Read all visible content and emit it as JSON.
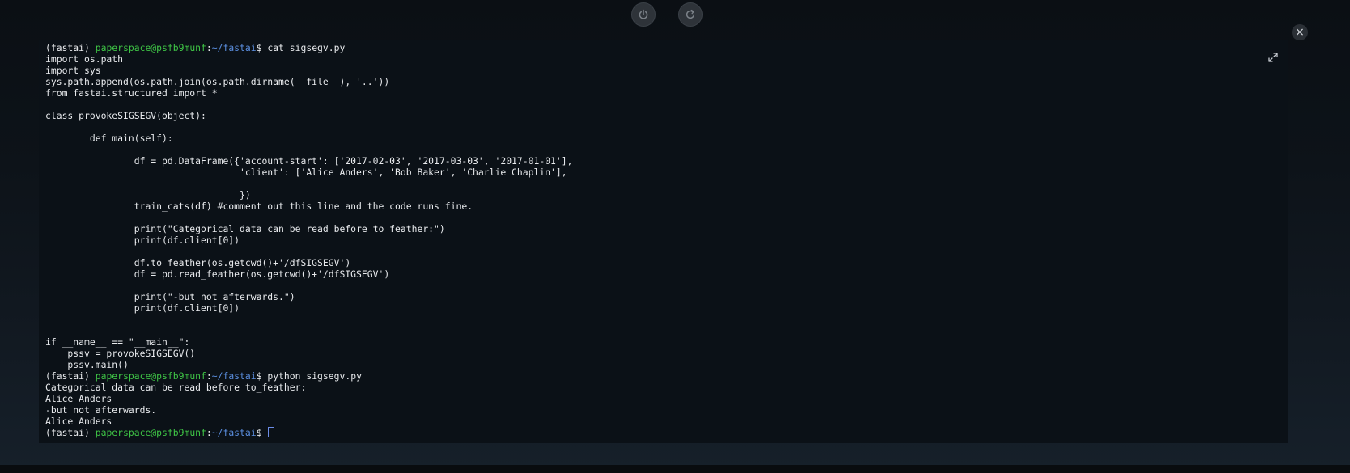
{
  "prompt": {
    "venv": "(fastai)",
    "userhost": "paperspace@psfb9munf",
    "sep": ":",
    "path": "~/fastai",
    "dollar": "$"
  },
  "lines": [
    {
      "type": "prompt",
      "cmd": " cat sigsegv.py"
    },
    {
      "type": "text",
      "text": "import os.path"
    },
    {
      "type": "text",
      "text": "import sys"
    },
    {
      "type": "text",
      "text": "sys.path.append(os.path.join(os.path.dirname(__file__), '..'))"
    },
    {
      "type": "text",
      "text": "from fastai.structured import *"
    },
    {
      "type": "text",
      "text": ""
    },
    {
      "type": "text",
      "text": "class provokeSIGSEGV(object):"
    },
    {
      "type": "text",
      "text": ""
    },
    {
      "type": "text",
      "text": "        def main(self):"
    },
    {
      "type": "text",
      "text": ""
    },
    {
      "type": "text",
      "text": "                df = pd.DataFrame({'account-start': ['2017-02-03', '2017-03-03', '2017-01-01'],"
    },
    {
      "type": "text",
      "text": "                                   'client': ['Alice Anders', 'Bob Baker', 'Charlie Chaplin'],"
    },
    {
      "type": "text",
      "text": ""
    },
    {
      "type": "text",
      "text": "                                   })"
    },
    {
      "type": "text",
      "text": "                train_cats(df) #comment out this line and the code runs fine."
    },
    {
      "type": "text",
      "text": ""
    },
    {
      "type": "text",
      "text": "                print(\"Categorical data can be read before to_feather:\")"
    },
    {
      "type": "text",
      "text": "                print(df.client[0])"
    },
    {
      "type": "text",
      "text": ""
    },
    {
      "type": "text",
      "text": "                df.to_feather(os.getcwd()+'/dfSIGSEGV')"
    },
    {
      "type": "text",
      "text": "                df = pd.read_feather(os.getcwd()+'/dfSIGSEGV')"
    },
    {
      "type": "text",
      "text": ""
    },
    {
      "type": "text",
      "text": "                print(\"-but not afterwards.\")"
    },
    {
      "type": "text",
      "text": "                print(df.client[0])"
    },
    {
      "type": "text",
      "text": ""
    },
    {
      "type": "text",
      "text": ""
    },
    {
      "type": "text",
      "text": "if __name__ == \"__main__\":"
    },
    {
      "type": "text",
      "text": "    pssv = provokeSIGSEGV()"
    },
    {
      "type": "text",
      "text": "    pssv.main()"
    },
    {
      "type": "prompt",
      "cmd": " python sigsegv.py"
    },
    {
      "type": "text",
      "text": "Categorical data can be read before to_feather:"
    },
    {
      "type": "text",
      "text": "Alice Anders"
    },
    {
      "type": "text",
      "text": "-but not afterwards."
    },
    {
      "type": "text",
      "text": "Alice Anders"
    },
    {
      "type": "prompt",
      "cmd": " ",
      "cursor": true
    }
  ],
  "icons": {
    "power": "power-icon",
    "restart": "restart-icon",
    "close": "close-icon",
    "expand": "expand-icon"
  },
  "close_glyph": "×",
  "colors": {
    "userhost": "#3fc546",
    "path": "#5b8fe0",
    "text": "#e8eaed",
    "terminal_bg": "#0b1117"
  }
}
